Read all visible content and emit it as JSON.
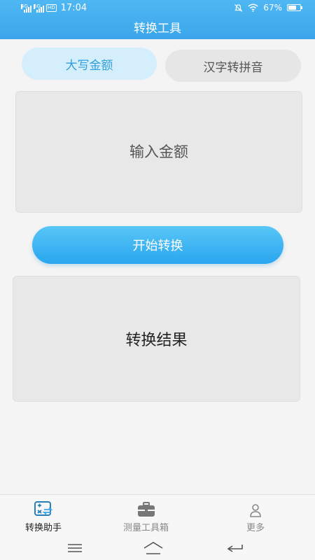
{
  "status_bar": {
    "sim1": "4G",
    "sim2": "5G",
    "hd": "HD",
    "time": "17:04",
    "battery": "67%",
    "battery_level": 0.67
  },
  "header": {
    "title": "转换工具"
  },
  "tabs": [
    {
      "label": "大写金额",
      "active": true
    },
    {
      "label": "汉字转拼音",
      "active": false
    }
  ],
  "input": {
    "placeholder": "输入金额",
    "value": ""
  },
  "convert_button": {
    "label": "开始转换"
  },
  "result": {
    "text": "转换结果"
  },
  "bottom_nav": [
    {
      "label": "转换助手",
      "icon": "calculator-icon",
      "active": true
    },
    {
      "label": "测量工具箱",
      "icon": "toolbox-icon",
      "active": false
    },
    {
      "label": "更多",
      "icon": "person-icon",
      "active": false
    }
  ],
  "colors": {
    "accent": "#3aa6ea",
    "tab_active_bg": "#d5eefb",
    "tab_active_text": "#2f9fdc"
  }
}
